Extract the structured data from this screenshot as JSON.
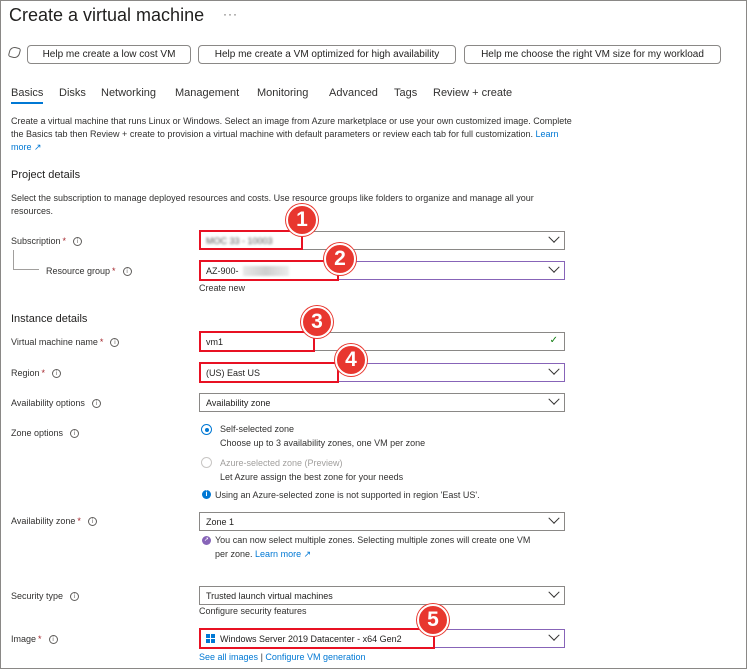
{
  "header": {
    "title": "Create a virtual machine",
    "more": "···"
  },
  "assist_buttons": [
    "Help me create a low cost VM",
    "Help me create a VM optimized for high availability",
    "Help me choose the right VM size for my workload"
  ],
  "tabs": [
    "Basics",
    "Disks",
    "Networking",
    "Management",
    "Monitoring",
    "Advanced",
    "Tags",
    "Review + create"
  ],
  "intro": {
    "text": "Create a virtual machine that runs Linux or Windows. Select an image from Azure marketplace or use your own customized image. Complete the Basics tab then Review + create to provision a virtual machine with default parameters or review each tab for full customization.",
    "link": "Learn more"
  },
  "project": {
    "heading": "Project details",
    "desc": "Select the subscription to manage deployed resources and costs. Use resource groups like folders to organize and manage all your resources.",
    "subscription_label": "Subscription",
    "subscription_value": "MOC 33 - 10003",
    "resource_group_label": "Resource group",
    "resource_group_value": "AZ-900-",
    "create_new": "Create new"
  },
  "instance": {
    "heading": "Instance details",
    "vm_name_label": "Virtual machine name",
    "vm_name_value": "vm1",
    "region_label": "Region",
    "region_value": "(US) East US",
    "availability_label": "Availability options",
    "availability_value": "Availability zone",
    "zone_options_label": "Zone options",
    "zone_self_title": "Self-selected zone",
    "zone_self_desc": "Choose up to 3 availability zones, one VM per zone",
    "zone_azure_title": "Azure-selected zone (Preview)",
    "zone_azure_desc": "Let Azure assign the best zone for your needs",
    "zone_note": "Using an Azure-selected zone is not supported in region 'East US'.",
    "zone_label": "Availability zone",
    "zone_value": "Zone 1",
    "zone_tip_line1": "You can now select multiple zones. Selecting multiple zones will create one VM",
    "zone_tip_line2": "per zone.",
    "zone_tip_link": "Learn more",
    "security_label": "Security type",
    "security_value": "Trusted launch virtual machines",
    "security_link": "Configure security features",
    "image_label": "Image",
    "image_value": "Windows Server 2019 Datacenter - x64 Gen2",
    "image_link1": "See all images",
    "image_sep": "|",
    "image_link2": "Configure VM generation"
  },
  "callouts": [
    "1",
    "2",
    "3",
    "4",
    "5"
  ],
  "colors": {
    "accent": "#0078d4",
    "callout": "#e8372f",
    "highlight_border": "#e81123",
    "focus": "#8764b8",
    "valid": "#107c10"
  }
}
